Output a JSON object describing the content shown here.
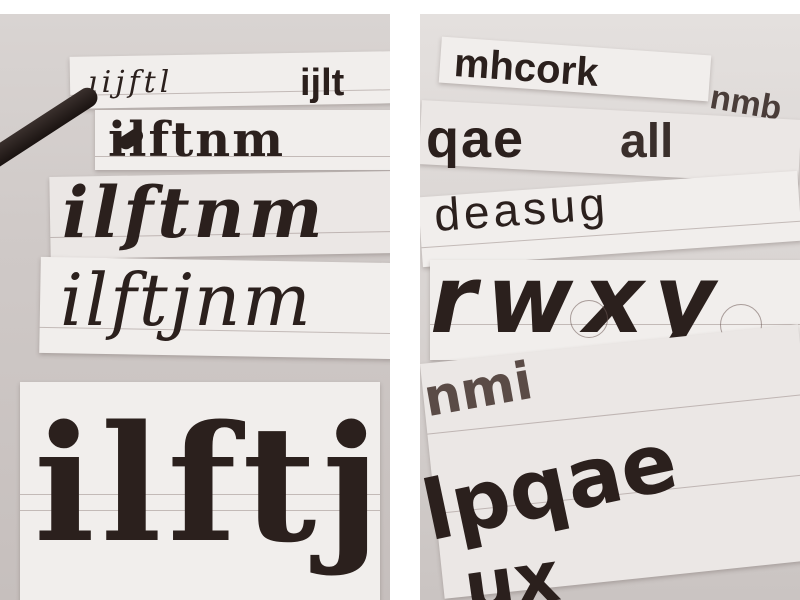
{
  "left_panel": {
    "row1": "ıijftl",
    "row1_tail": "ijlt",
    "row2": "ilftnm",
    "row3": "ilftnm",
    "row4": "ilftjnm",
    "row5": "ilftj"
  },
  "right_panel": {
    "row1": "mhcork",
    "row1_tail": "nmb",
    "row2": "qae",
    "row2_tail": "all",
    "row3": "deasug",
    "row4": "rwxy",
    "row5": "nmi",
    "row6": "lpqae",
    "row7": "ux"
  },
  "colors": {
    "ink": "#2b201d",
    "paper": "#f1eeec",
    "background": "#d2ccca"
  }
}
